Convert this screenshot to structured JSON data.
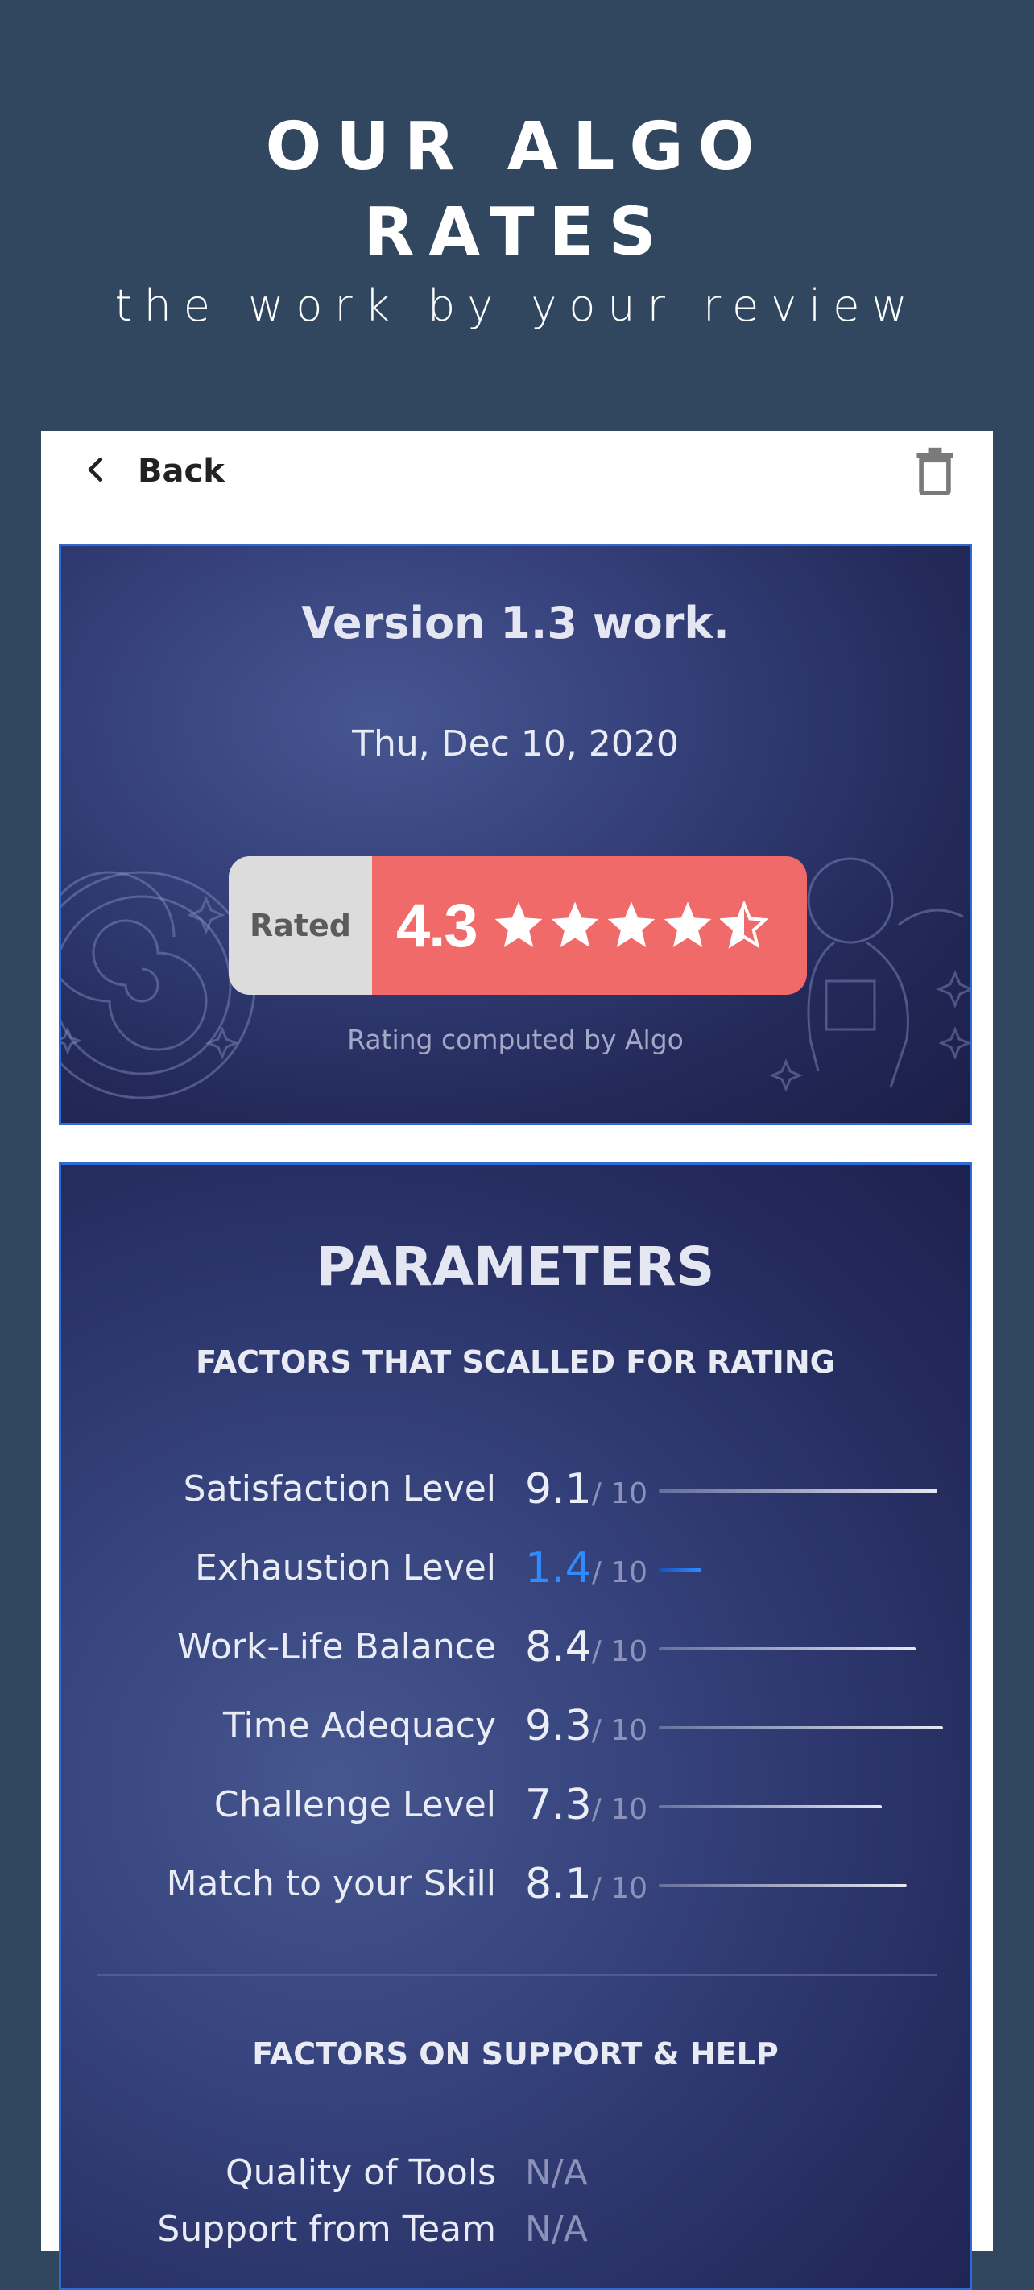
{
  "hero": {
    "title_line1": "OUR ALGO",
    "title_line2": "RATES",
    "subtitle": "the work by your review"
  },
  "topbar": {
    "back_label": "Back",
    "back_icon": "chevron-left-icon",
    "delete_icon": "trash-icon"
  },
  "summary_card": {
    "title": "Version 1.3 work.",
    "date": "Thu, Dec 10, 2020",
    "rated_label": "Rated",
    "rating": "4.3",
    "stars": 4.5,
    "note": "Rating computed by Algo",
    "colors": {
      "badge": "#ef6a68",
      "badge_label_bg": "#dcdcdc"
    }
  },
  "parameters": {
    "title": "PARAMETERS",
    "section1_title": "FACTORS THAT SCALLED FOR RATING",
    "factors": [
      {
        "label": "Satisfaction Level",
        "value": "9.1",
        "of": "/ 10",
        "fraction": 0.91
      },
      {
        "label": "Exhaustion Level",
        "value": "1.4",
        "of": "/ 10",
        "fraction": 0.14,
        "accent": "#2f8cff"
      },
      {
        "label": "Work-Life Balance",
        "value": "8.4",
        "of": "/ 10",
        "fraction": 0.84
      },
      {
        "label": "Time Adequacy",
        "value": "9.3",
        "of": "/ 10",
        "fraction": 0.93
      },
      {
        "label": "Challenge  Level",
        "value": "7.3",
        "of": "/ 10",
        "fraction": 0.73
      },
      {
        "label": "Match to your Skill",
        "value": "8.1",
        "of": "/ 10",
        "fraction": 0.81
      }
    ],
    "section2_title": "FACTORS ON SUPPORT & HELP",
    "support": [
      {
        "label": "Quality of Tools",
        "value": "N/A"
      },
      {
        "label": "Support from Team",
        "value": "N/A"
      }
    ]
  }
}
